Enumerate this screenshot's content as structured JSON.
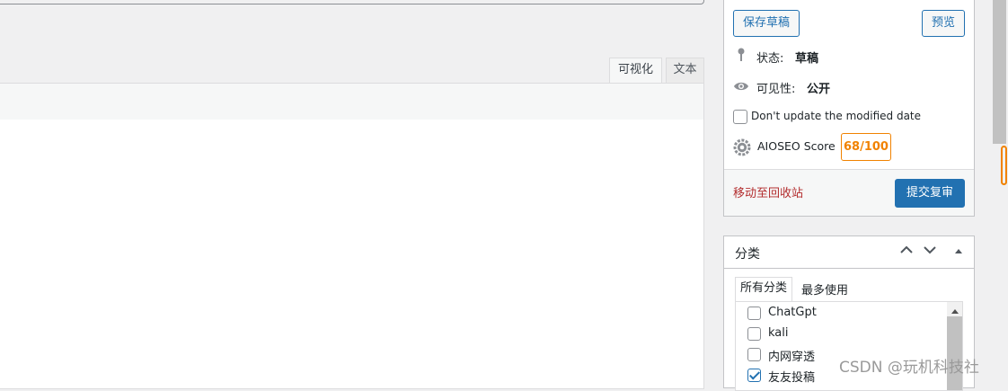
{
  "editor": {
    "tabs": [
      {
        "label": "可视化"
      },
      {
        "label": "文本"
      }
    ]
  },
  "publish": {
    "save_draft_label": "保存草稿",
    "preview_label": "预览",
    "status_label": "状态:",
    "status_value": "草稿",
    "visibility_label": "可见性:",
    "visibility_value": "公开",
    "dont_update_modified_label": "Don't update the modified date",
    "aioseo_label": "AIOSEO Score",
    "aioseo_score": "68/100",
    "trash_label": "移动至回收站",
    "submit_label": "提交复审"
  },
  "categories": {
    "title": "分类",
    "tab_all": "所有分类",
    "tab_popular": "最多使用",
    "items": [
      {
        "label": "ChatGpt",
        "checked": false
      },
      {
        "label": "kali",
        "checked": false
      },
      {
        "label": "内网穿透",
        "checked": false
      },
      {
        "label": "友友投稿",
        "checked": true
      }
    ]
  },
  "watermark": "CSDN @玩机科技社",
  "colors": {
    "accent": "#2271b1",
    "score": "#f18200",
    "trash": "#b32d2e"
  }
}
